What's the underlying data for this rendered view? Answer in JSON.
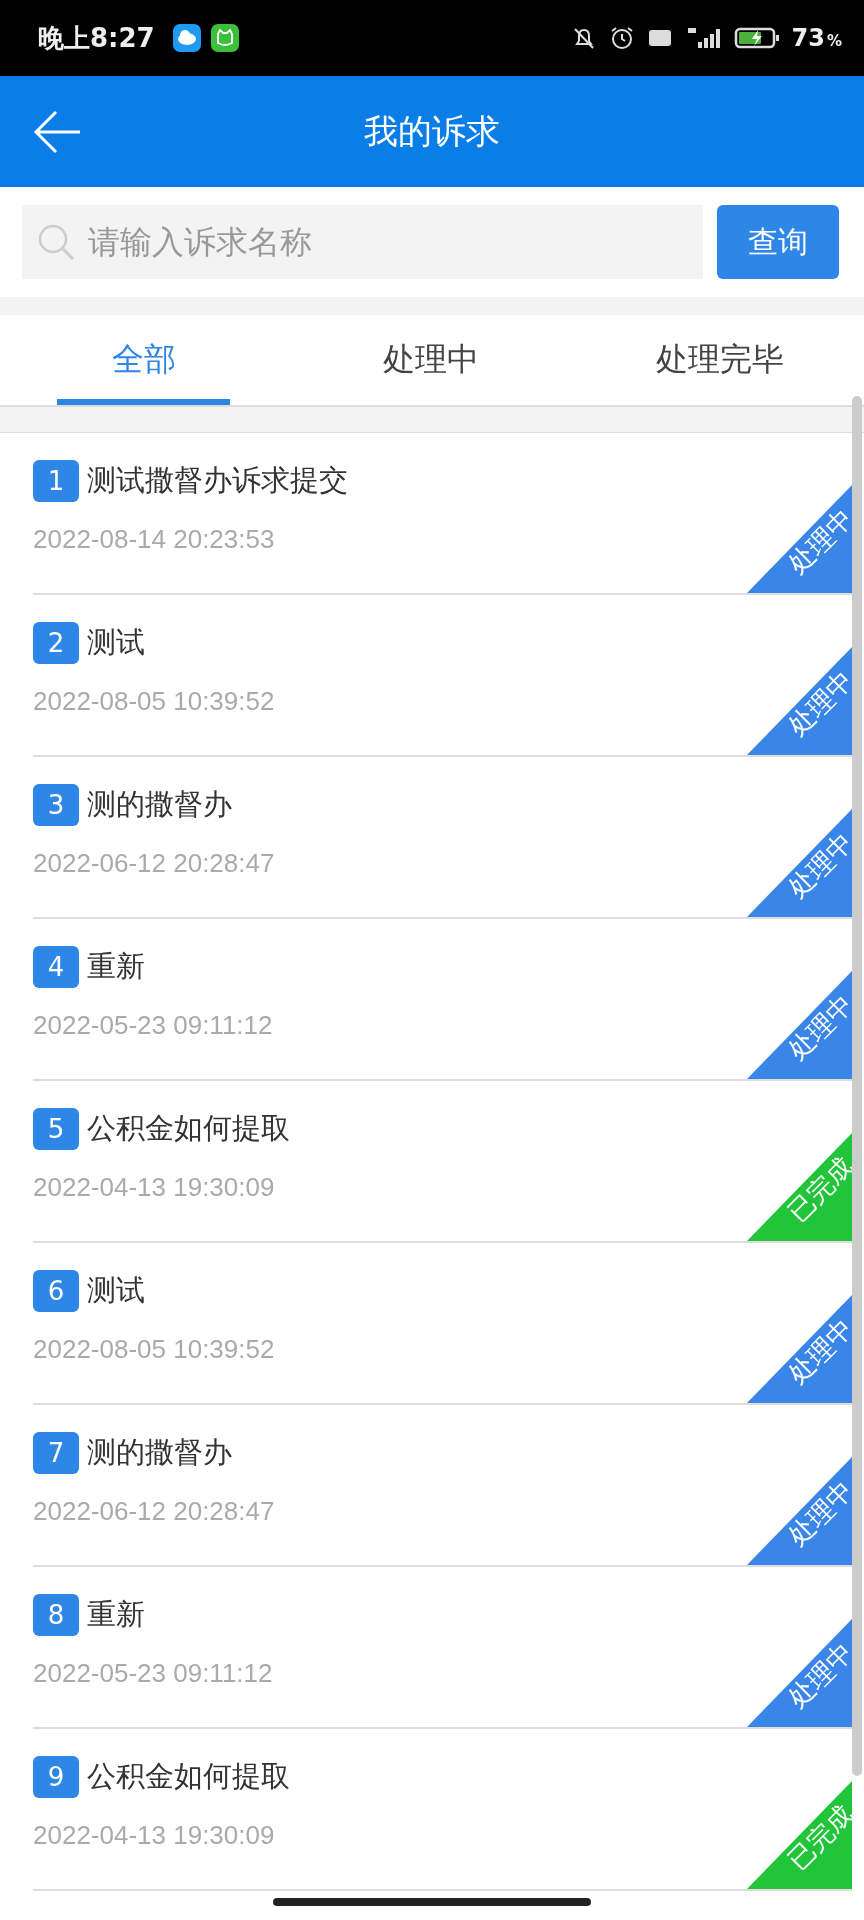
{
  "status_bar": {
    "time": "晚上8:27",
    "battery": "73",
    "battery_unit": "%"
  },
  "header": {
    "title": "我的诉求"
  },
  "search": {
    "placeholder": "请输入诉求名称",
    "button": "查询"
  },
  "tabs": [
    {
      "label": "全部",
      "selected": true
    },
    {
      "label": "处理中",
      "selected": false
    },
    {
      "label": "处理完毕",
      "selected": false
    }
  ],
  "items": [
    {
      "number": "1",
      "title": "测试撒督办诉求提交",
      "date": "2022-08-14 20:23:53",
      "status": {
        "kind": "processing",
        "label": "处理中"
      }
    },
    {
      "number": "2",
      "title": "测试",
      "date": "2022-08-05 10:39:52",
      "status": {
        "kind": "processing",
        "label": "处理中"
      }
    },
    {
      "number": "3",
      "title": "测的撒督办",
      "date": "2022-06-12 20:28:47",
      "status": {
        "kind": "processing",
        "label": "处理中"
      }
    },
    {
      "number": "4",
      "title": "重新",
      "date": "2022-05-23 09:11:12",
      "status": {
        "kind": "processing",
        "label": "处理中"
      }
    },
    {
      "number": "5",
      "title": "公积金如何提取",
      "date": "2022-04-13 19:30:09",
      "status": {
        "kind": "done",
        "label": "已完成"
      }
    },
    {
      "number": "6",
      "title": "测试",
      "date": "2022-08-05 10:39:52",
      "status": {
        "kind": "processing",
        "label": "处理中"
      }
    },
    {
      "number": "7",
      "title": "测的撒督办",
      "date": "2022-06-12 20:28:47",
      "status": {
        "kind": "processing",
        "label": "处理中"
      }
    },
    {
      "number": "8",
      "title": "重新",
      "date": "2022-05-23 09:11:12",
      "status": {
        "kind": "processing",
        "label": "处理中"
      }
    },
    {
      "number": "9",
      "title": "公积金如何提取",
      "date": "2022-04-13 19:30:09",
      "status": {
        "kind": "done",
        "label": "已完成"
      }
    }
  ]
}
